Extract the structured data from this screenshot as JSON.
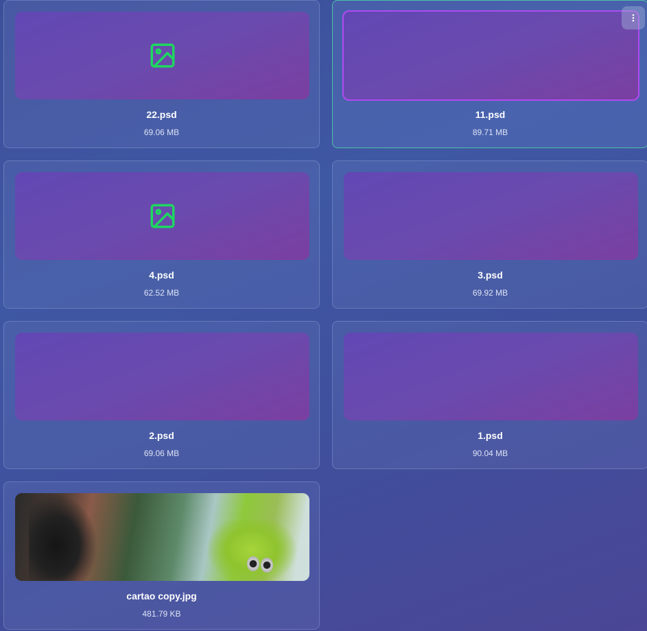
{
  "files": [
    {
      "name": "22.psd",
      "size": "69.06 MB",
      "thumbnail": "image-icon",
      "selected": false
    },
    {
      "name": "11.psd",
      "size": "89.71 MB",
      "thumbnail": "blank",
      "selected": true
    },
    {
      "name": "4.psd",
      "size": "62.52 MB",
      "thumbnail": "image-icon",
      "selected": false
    },
    {
      "name": "3.psd",
      "size": "69.92 MB",
      "thumbnail": "blank",
      "selected": false
    },
    {
      "name": "2.psd",
      "size": "69.06 MB",
      "thumbnail": "blank",
      "selected": false
    },
    {
      "name": "1.psd",
      "size": "90.04 MB",
      "thumbnail": "blank",
      "selected": false
    },
    {
      "name": "cartao copy.jpg",
      "size": "481.79 KB",
      "thumbnail": "photo",
      "selected": false
    }
  ],
  "icons": {
    "placeholder": "image-icon",
    "menu": "more-vertical-icon"
  },
  "colors": {
    "icon_accent": "#1ed760",
    "selected_border": "#4fc1a8",
    "selected_thumb_border": "#b04af0"
  }
}
